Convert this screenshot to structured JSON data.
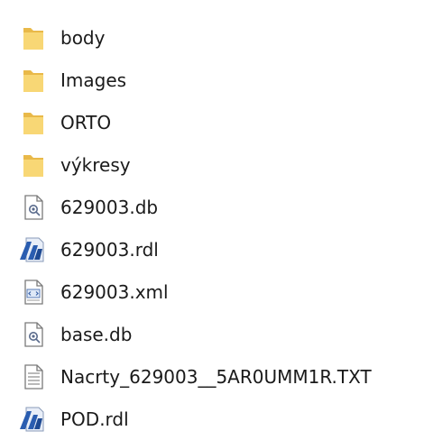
{
  "explorer": {
    "items": [
      {
        "name": "body",
        "icon": "folder-icon"
      },
      {
        "name": "Images",
        "icon": "folder-icon"
      },
      {
        "name": "ORTO",
        "icon": "folder-icon"
      },
      {
        "name": "výkresy",
        "icon": "folder-icon"
      },
      {
        "name": "629003.db",
        "icon": "database-file-icon"
      },
      {
        "name": "629003.rdl",
        "icon": "rdl-app-file-icon"
      },
      {
        "name": "629003.xml",
        "icon": "xml-file-icon"
      },
      {
        "name": "base.db",
        "icon": "database-file-icon"
      },
      {
        "name": "Nacrty_629003__5AR0UMM1R.TXT",
        "icon": "text-file-icon"
      },
      {
        "name": "POD.rdl",
        "icon": "rdl-app-file-icon"
      }
    ]
  },
  "colors": {
    "folder": "#f8d775",
    "folder_shade": "#e9b949",
    "rdl_blue": "#2a5db0",
    "text": "#1a1a1a"
  }
}
